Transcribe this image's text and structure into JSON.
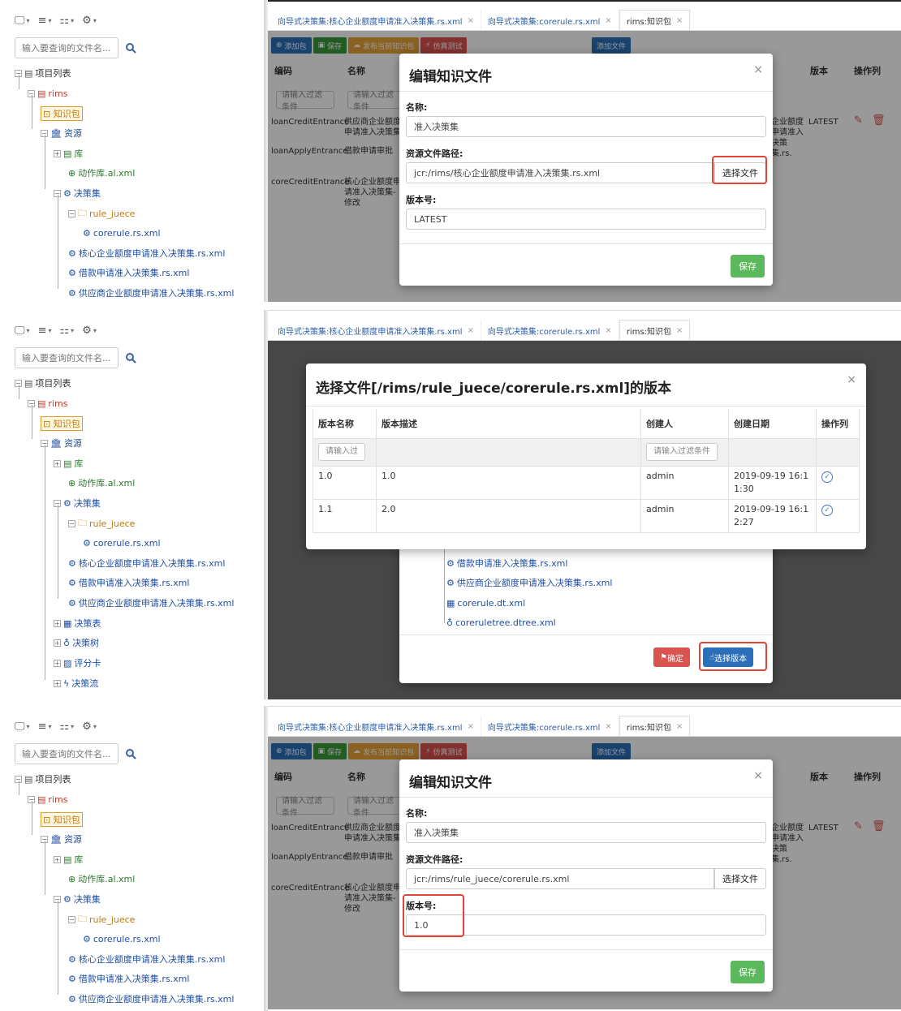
{
  "toolbar": {
    "glyphs": [
      "🖵",
      "≡",
      "⚏",
      "⚙"
    ]
  },
  "search": {
    "placeholder": "输入要查询的文件名..."
  },
  "tree": {
    "root": "项目列表",
    "project": "rims",
    "kpack": "知识包",
    "resources": "资源",
    "lib": "库",
    "action_lib": "动作库.al.xml",
    "ruleset": "决策集",
    "rule_folder": "rule_juece",
    "corerule": "corerule.rs.xml",
    "item1": "核心企业额度申请准入决策集.rs.xml",
    "item2": "借款申请准入决策集.rs.xml",
    "item3": "供应商企业额度申请准入决策集.rs.xml",
    "dtable": "决策表",
    "dtree": "决策树",
    "scorecard": "评分卡",
    "flow": "决策流"
  },
  "tabs": [
    {
      "label": "向导式决策集:核心企业额度申请准入决策集.rs.xml"
    },
    {
      "label": "向导式决策集:corerule.rs.xml"
    },
    {
      "label": "rims:知识包"
    }
  ],
  "right_buttons": {
    "add_pkg": "添加包",
    "save": "保存",
    "publish": "发布当前知识包",
    "simulate": "仿真测试",
    "add_file": "添加文件"
  },
  "grid": {
    "headers": {
      "code": "编码",
      "name": "名称",
      "version": "版本",
      "ops": "操作列"
    },
    "filter_placeholder": "请输入过滤条件",
    "rows": [
      {
        "code": "loanCreditEntrance",
        "name": "供应商企业额度申请准入决策集"
      },
      {
        "code": "loanApplyEntrance",
        "name": "借款申请审批"
      },
      {
        "code": "coreCreditEntrance",
        "name": "核心企业额度申请准入决策集-修改"
      }
    ],
    "side_text": "企业额度申请准入决策集.rs.",
    "side_version": "LATEST"
  },
  "edit_modal": {
    "title": "编辑知识文件",
    "close": "×",
    "name_label": "名称:",
    "name_value": "准入决策集",
    "path_label": "资源文件路径:",
    "path_value_1": "jcr:/rims/核心企业额度申请准入决策集.rs.xml",
    "path_value_3": "jcr:/rims/rule_juece/corerule.rs.xml",
    "file_btn": "选择文件",
    "version_label": "版本号:",
    "version_value_1": "LATEST",
    "version_value_3": "1.0",
    "save": "保存"
  },
  "version_modal": {
    "title": "选择文件[/rims/rule_juece/corerule.rs.xml]的版本",
    "close": "×",
    "headers": {
      "name": "版本名称",
      "desc": "版本描述",
      "creator": "创建人",
      "date": "创建日期",
      "ops": "操作列"
    },
    "filter_short": "请输入过",
    "filter_long": "请输入过滤条件",
    "rows": [
      {
        "name": "1.0",
        "desc": "1.0",
        "creator": "admin",
        "date": "2019-09-19 16:11:30"
      },
      {
        "name": "1.1",
        "desc": "2.0",
        "creator": "admin",
        "date": "2019-09-19 16:12:27"
      }
    ]
  },
  "file_tree_bg": {
    "items": [
      "借款申请准入决策集.rs.xml",
      "供应商企业额度申请准入决策集.rs.xml",
      "corerule.dt.xml",
      "coreruletree.dtree.xml"
    ],
    "confirm": "确定",
    "select_version": "选择版本"
  },
  "colors": {
    "accent_blue": "#2b6fb8",
    "success": "#5cb85c",
    "danger": "#d9534f",
    "highlight_red": "#e0453a"
  }
}
